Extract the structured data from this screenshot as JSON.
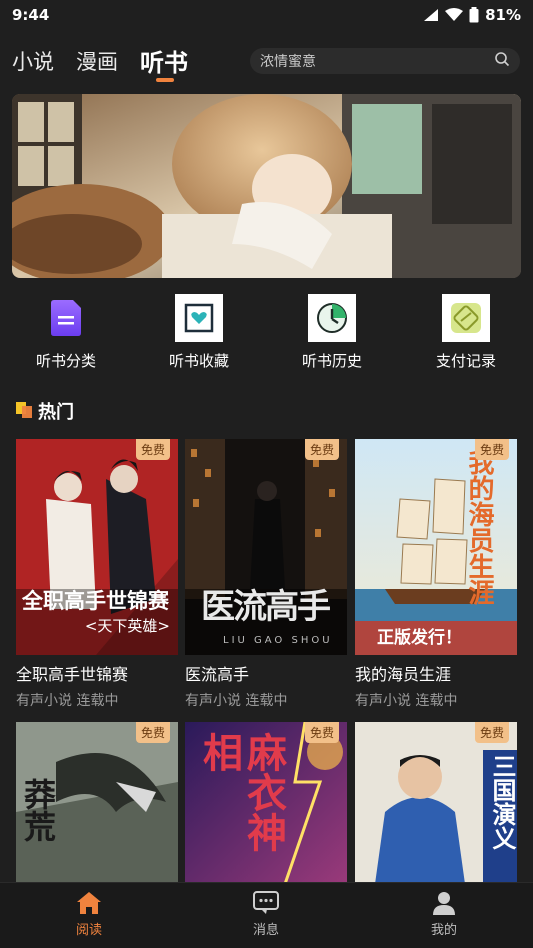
{
  "status": {
    "time": "9:44",
    "battery": "81%"
  },
  "nav": {
    "tabs": [
      {
        "label": "小说"
      },
      {
        "label": "漫画"
      },
      {
        "label": "听书",
        "active": true
      }
    ],
    "search_placeholder": "浓情蜜意"
  },
  "quick_links": [
    {
      "label": "听书分类",
      "icon": "category-icon"
    },
    {
      "label": "听书收藏",
      "icon": "favorite-icon"
    },
    {
      "label": "听书历史",
      "icon": "history-icon"
    },
    {
      "label": "支付记录",
      "icon": "payment-icon"
    }
  ],
  "section": {
    "title": "热门"
  },
  "books": [
    {
      "title": "全职高手世锦赛",
      "subtitle": "有声小说 连载中",
      "badge": "免费",
      "cover_text": "全职高手世锦赛",
      "cover_sub": "<天下英雄>"
    },
    {
      "title": "医流高手",
      "subtitle": "有声小说 连载中",
      "badge": "免费",
      "cover_text": "医流高手",
      "cover_sub": "LIU GAO SHOU"
    },
    {
      "title": "我的海员生涯",
      "subtitle": "有声小说 连载中",
      "badge": "免费",
      "cover_text": "我的海员生涯",
      "cover_sub": "正版发行！"
    },
    {
      "badge": "免费",
      "cover_text": "莽荒"
    },
    {
      "badge": "免费",
      "cover_text": "麻衣神相"
    },
    {
      "badge": "免费",
      "cover_text": "三国演义"
    }
  ],
  "bottom_nav": [
    {
      "label": "阅读",
      "icon": "home-icon",
      "active": true
    },
    {
      "label": "消息",
      "icon": "message-icon"
    },
    {
      "label": "我的",
      "icon": "profile-icon"
    }
  ],
  "colors": {
    "accent": "#f0833e",
    "background": "#1f1f1f",
    "badge": "#f2c089"
  }
}
